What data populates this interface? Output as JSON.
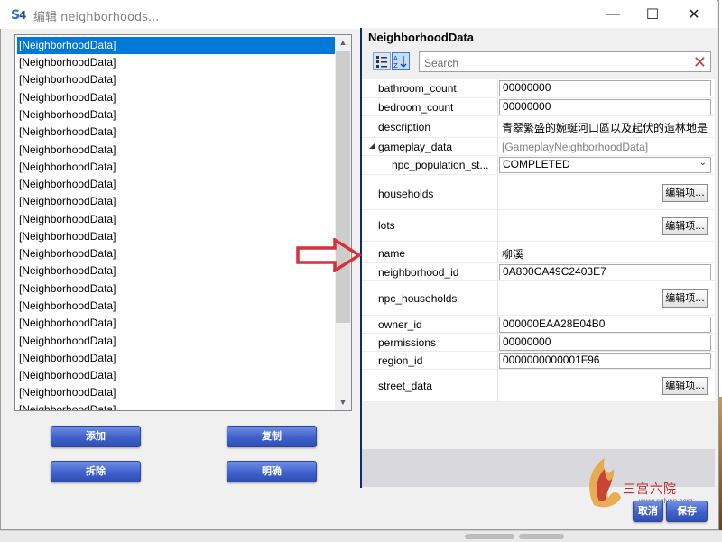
{
  "window": {
    "title": "编辑 neighborhoods...",
    "minimize_glyph": "—",
    "maximize_glyph": "☐",
    "close_glyph": "✕"
  },
  "list": {
    "items": [
      "[NeighborhoodData]",
      "[NeighborhoodData]",
      "[NeighborhoodData]",
      "[NeighborhoodData]",
      "[NeighborhoodData]",
      "[NeighborhoodData]",
      "[NeighborhoodData]",
      "[NeighborhoodData]",
      "[NeighborhoodData]",
      "[NeighborhoodData]",
      "[NeighborhoodData]",
      "[NeighborhoodData]",
      "[NeighborhoodData]",
      "[NeighborhoodData]",
      "[NeighborhoodData]",
      "[NeighborhoodData]",
      "[NeighborhoodData]",
      "[NeighborhoodData]",
      "[NeighborhoodData]",
      "[NeighborhoodData]",
      "[NeighborhoodData]",
      "[NeighborhoodData]"
    ],
    "selected_index": 0
  },
  "buttons": {
    "add": "添加",
    "copy": "复制",
    "remove": "拆除",
    "confirm": "明确",
    "cancel": "取消",
    "save": "保存"
  },
  "panel": {
    "header": "NeighborhoodData",
    "search_placeholder": "Search",
    "edit_label": "编辑项...",
    "properties": {
      "bathroom_count": {
        "name": "bathroom_count",
        "value": "00000000"
      },
      "bedroom_count": {
        "name": "bedroom_count",
        "value": "00000000"
      },
      "description": {
        "name": "description",
        "value": "青翠繁盛的婉蜒河口區以及起伏的造林地是"
      },
      "gameplay_data": {
        "name": "gameplay_data",
        "value": "[GameplayNeighborhoodData]"
      },
      "npc_population_state": {
        "name": "npc_population_st...",
        "value": "COMPLETED"
      },
      "households": {
        "name": "households"
      },
      "lots": {
        "name": "lots"
      },
      "name": {
        "name": "name",
        "value": "柳溪"
      },
      "neighborhood_id": {
        "name": "neighborhood_id",
        "value": "0A800CA49C2403E7"
      },
      "npc_households": {
        "name": "npc_households"
      },
      "owner_id": {
        "name": "owner_id",
        "value": "000000EAA28E04B0"
      },
      "permissions": {
        "name": "permissions",
        "value": "00000000"
      },
      "region_id": {
        "name": "region_id",
        "value": "0000000000001F96"
      },
      "street_data": {
        "name": "street_data"
      }
    }
  },
  "watermark": {
    "text": "三宫六院",
    "url": "www.sglynp.com"
  },
  "colors": {
    "selection": "#0078d7",
    "button_blue": "#3f61c9",
    "arrow_red": "#d8303a",
    "panel_border": "#0a2d6e"
  }
}
